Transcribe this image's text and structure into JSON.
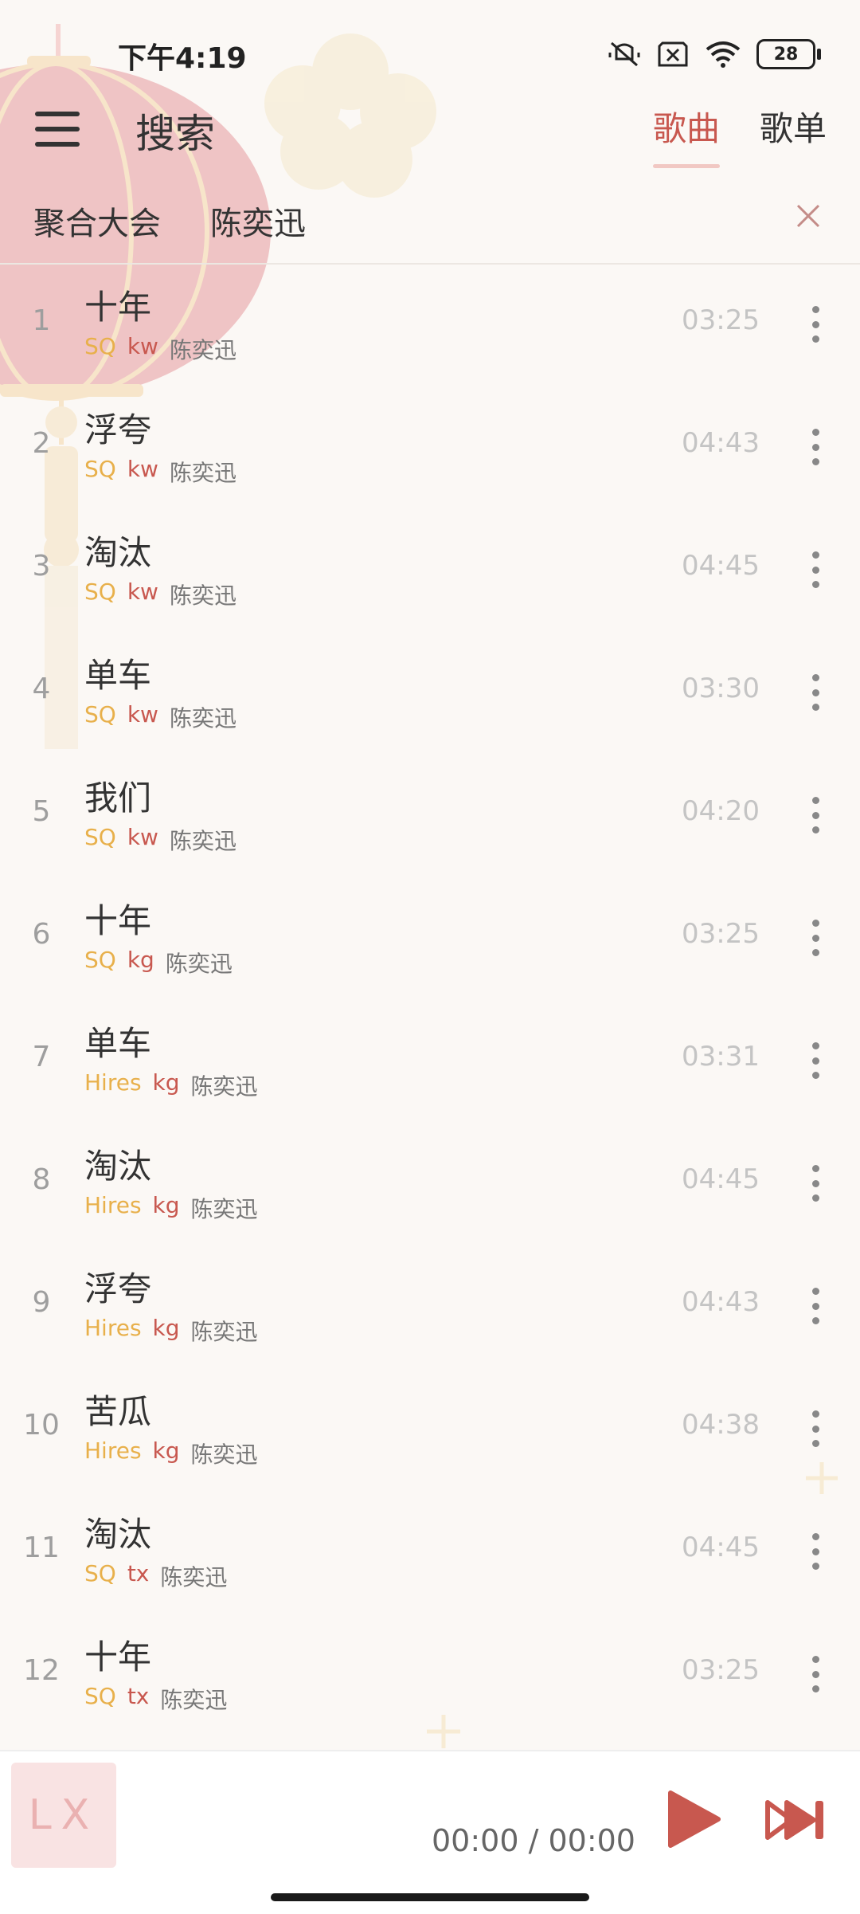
{
  "status_bar": {
    "time": "下午4:19",
    "battery": "28"
  },
  "header": {
    "title": "搜索",
    "tabs": [
      {
        "label": "歌曲",
        "active": true
      },
      {
        "label": "歌单",
        "active": false
      }
    ]
  },
  "search": {
    "source": "聚合大会",
    "query": "陈奕迅"
  },
  "songs": [
    {
      "num": "1",
      "title": "十年",
      "quality": "SQ",
      "source": "kw",
      "artist": "陈奕迅",
      "duration": "03:25"
    },
    {
      "num": "2",
      "title": "浮夸",
      "quality": "SQ",
      "source": "kw",
      "artist": "陈奕迅",
      "duration": "04:43"
    },
    {
      "num": "3",
      "title": "淘汰",
      "quality": "SQ",
      "source": "kw",
      "artist": "陈奕迅",
      "duration": "04:45"
    },
    {
      "num": "4",
      "title": "单车",
      "quality": "SQ",
      "source": "kw",
      "artist": "陈奕迅",
      "duration": "03:30"
    },
    {
      "num": "5",
      "title": "我们",
      "quality": "SQ",
      "source": "kw",
      "artist": "陈奕迅",
      "duration": "04:20"
    },
    {
      "num": "6",
      "title": "十年",
      "quality": "SQ",
      "source": "kg",
      "artist": "陈奕迅",
      "duration": "03:25"
    },
    {
      "num": "7",
      "title": "单车",
      "quality": "Hires",
      "source": "kg",
      "artist": "陈奕迅",
      "duration": "03:31"
    },
    {
      "num": "8",
      "title": "淘汰",
      "quality": "Hires",
      "source": "kg",
      "artist": "陈奕迅",
      "duration": "04:45"
    },
    {
      "num": "9",
      "title": "浮夸",
      "quality": "Hires",
      "source": "kg",
      "artist": "陈奕迅",
      "duration": "04:43"
    },
    {
      "num": "10",
      "title": "苦瓜",
      "quality": "Hires",
      "source": "kg",
      "artist": "陈奕迅",
      "duration": "04:38"
    },
    {
      "num": "11",
      "title": "淘汰",
      "quality": "SQ",
      "source": "tx",
      "artist": "陈奕迅",
      "duration": "04:45"
    },
    {
      "num": "12",
      "title": "十年",
      "quality": "SQ",
      "source": "tx",
      "artist": "陈奕迅",
      "duration": "03:25"
    }
  ],
  "player": {
    "logo": "LX",
    "time": "00:00 / 00:00"
  },
  "colors": {
    "accent": "#c8584f",
    "quality_tag": "#e8b04b",
    "background": "#fbf8f5"
  },
  "icons": {
    "menu": "hamburger-icon",
    "clear": "close-icon",
    "more": "more-vertical-icon",
    "play": "play-icon",
    "next": "skip-next-icon"
  }
}
